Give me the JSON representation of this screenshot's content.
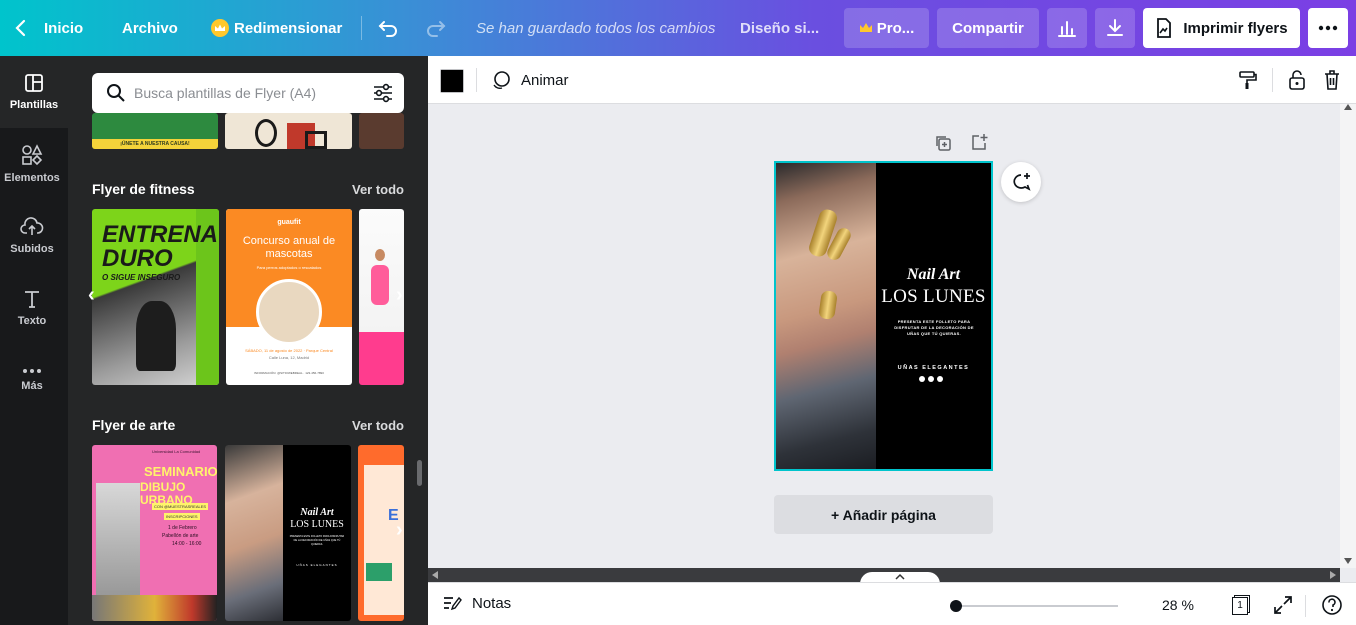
{
  "topbar": {
    "home_label": "Inicio",
    "file_label": "Archivo",
    "resize_label": "Redimensionar",
    "status_text": "Se han guardado todos los cambios",
    "design_name": "Diseño si...",
    "pro_label": "Pro...",
    "share_label": "Compartir",
    "print_label": "Imprimir flyers"
  },
  "rail": {
    "items": [
      {
        "label": "Plantillas"
      },
      {
        "label": "Elementos"
      },
      {
        "label": "Subidos"
      },
      {
        "label": "Texto"
      },
      {
        "label": "Más"
      }
    ]
  },
  "panel": {
    "search_placeholder": "Busca plantillas de Flyer (A4)",
    "top_strip_text": "¡ÚNETE A NUESTRA CAUSA!",
    "sections": [
      {
        "title": "Flyer de fitness",
        "link": "Ver todo"
      },
      {
        "title": "Flyer de arte",
        "link": "Ver todo"
      }
    ],
    "fitness_thumb1": {
      "line1": "ENTRENA",
      "line2": "DURO",
      "line3": "O SIGUE INSEGURO"
    },
    "fitness_thumb2": {
      "brand": "guaufit",
      "title": "Concurso anual de mascotas",
      "subtitle": "Para perros adoptados o rescatados",
      "date": "SÁBADO, 11 de agosto de 2022 · Parque Central",
      "place": "Calle Luna, 12, Madrid",
      "footer": "INFORMACIÓN: @SITIOWEBREAL · 123-456-7890"
    },
    "art_thumb1": {
      "top": "Universidad La Comunidad",
      "title1": "SEMINARIO",
      "title2": "DIBUJO URBANO",
      "tag1": "CON @MUESTRASREALES",
      "tag2": "INSCRIPCIONES",
      "date": "1 de Febrero",
      "place": "Pabellón de arte",
      "time": "14:00 - 16:00"
    },
    "art_thumb2": {
      "title1": "Nail Art",
      "title2": "LOS LUNES",
      "body": "PRESENTA ESTE FOLLETO PARA DISFRUTAR DE LA DECORACIÓN DE UÑAS QUE TÚ QUIERAS.",
      "footer": "UÑAS ELEGANTES"
    },
    "art_thumb3": {
      "letter": "E"
    }
  },
  "toolbar": {
    "animate_label": "Animar",
    "color_swatch": "#000000"
  },
  "page": {
    "title1": "Nail Art",
    "title2": "LOS LUNES",
    "body": "PRESENTA ESTE FOLLETO PARA DISFRUTAR DE LA DECORACIÓN DE UÑAS QUE TÚ QUIERAS.",
    "footer": "UÑAS ELEGANTES",
    "add_page_label": "+ Añadir página"
  },
  "bottombar": {
    "notes_label": "Notas",
    "zoom_value": "28 %",
    "page_count": "1"
  },
  "colors": {
    "accent": "#00c4cc",
    "purple": "#7b3fe4",
    "rail_bg": "#18191b",
    "panel_bg": "#252627"
  }
}
